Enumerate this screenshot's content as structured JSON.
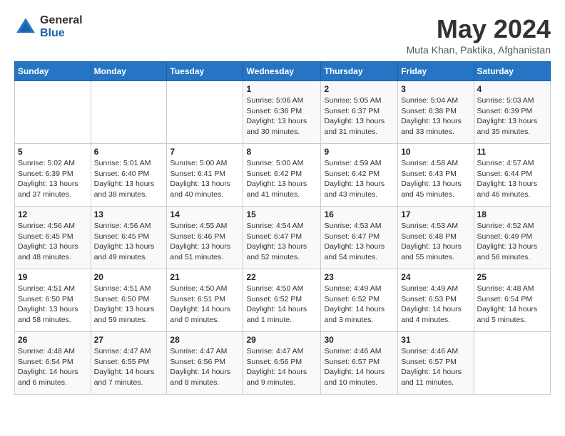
{
  "logo": {
    "general": "General",
    "blue": "Blue"
  },
  "title": "May 2024",
  "location": "Muta Khan, Paktika, Afghanistan",
  "days_header": [
    "Sunday",
    "Monday",
    "Tuesday",
    "Wednesday",
    "Thursday",
    "Friday",
    "Saturday"
  ],
  "weeks": [
    [
      {
        "day": "",
        "detail": ""
      },
      {
        "day": "",
        "detail": ""
      },
      {
        "day": "",
        "detail": ""
      },
      {
        "day": "1",
        "detail": "Sunrise: 5:06 AM\nSunset: 6:36 PM\nDaylight: 13 hours\nand 30 minutes."
      },
      {
        "day": "2",
        "detail": "Sunrise: 5:05 AM\nSunset: 6:37 PM\nDaylight: 13 hours\nand 31 minutes."
      },
      {
        "day": "3",
        "detail": "Sunrise: 5:04 AM\nSunset: 6:38 PM\nDaylight: 13 hours\nand 33 minutes."
      },
      {
        "day": "4",
        "detail": "Sunrise: 5:03 AM\nSunset: 6:39 PM\nDaylight: 13 hours\nand 35 minutes."
      }
    ],
    [
      {
        "day": "5",
        "detail": "Sunrise: 5:02 AM\nSunset: 6:39 PM\nDaylight: 13 hours\nand 37 minutes."
      },
      {
        "day": "6",
        "detail": "Sunrise: 5:01 AM\nSunset: 6:40 PM\nDaylight: 13 hours\nand 38 minutes."
      },
      {
        "day": "7",
        "detail": "Sunrise: 5:00 AM\nSunset: 6:41 PM\nDaylight: 13 hours\nand 40 minutes."
      },
      {
        "day": "8",
        "detail": "Sunrise: 5:00 AM\nSunset: 6:42 PM\nDaylight: 13 hours\nand 41 minutes."
      },
      {
        "day": "9",
        "detail": "Sunrise: 4:59 AM\nSunset: 6:42 PM\nDaylight: 13 hours\nand 43 minutes."
      },
      {
        "day": "10",
        "detail": "Sunrise: 4:58 AM\nSunset: 6:43 PM\nDaylight: 13 hours\nand 45 minutes."
      },
      {
        "day": "11",
        "detail": "Sunrise: 4:57 AM\nSunset: 6:44 PM\nDaylight: 13 hours\nand 46 minutes."
      }
    ],
    [
      {
        "day": "12",
        "detail": "Sunrise: 4:56 AM\nSunset: 6:45 PM\nDaylight: 13 hours\nand 48 minutes."
      },
      {
        "day": "13",
        "detail": "Sunrise: 4:56 AM\nSunset: 6:45 PM\nDaylight: 13 hours\nand 49 minutes."
      },
      {
        "day": "14",
        "detail": "Sunrise: 4:55 AM\nSunset: 6:46 PM\nDaylight: 13 hours\nand 51 minutes."
      },
      {
        "day": "15",
        "detail": "Sunrise: 4:54 AM\nSunset: 6:47 PM\nDaylight: 13 hours\nand 52 minutes."
      },
      {
        "day": "16",
        "detail": "Sunrise: 4:53 AM\nSunset: 6:47 PM\nDaylight: 13 hours\nand 54 minutes."
      },
      {
        "day": "17",
        "detail": "Sunrise: 4:53 AM\nSunset: 6:48 PM\nDaylight: 13 hours\nand 55 minutes."
      },
      {
        "day": "18",
        "detail": "Sunrise: 4:52 AM\nSunset: 6:49 PM\nDaylight: 13 hours\nand 56 minutes."
      }
    ],
    [
      {
        "day": "19",
        "detail": "Sunrise: 4:51 AM\nSunset: 6:50 PM\nDaylight: 13 hours\nand 58 minutes."
      },
      {
        "day": "20",
        "detail": "Sunrise: 4:51 AM\nSunset: 6:50 PM\nDaylight: 13 hours\nand 59 minutes."
      },
      {
        "day": "21",
        "detail": "Sunrise: 4:50 AM\nSunset: 6:51 PM\nDaylight: 14 hours\nand 0 minutes."
      },
      {
        "day": "22",
        "detail": "Sunrise: 4:50 AM\nSunset: 6:52 PM\nDaylight: 14 hours\nand 1 minute."
      },
      {
        "day": "23",
        "detail": "Sunrise: 4:49 AM\nSunset: 6:52 PM\nDaylight: 14 hours\nand 3 minutes."
      },
      {
        "day": "24",
        "detail": "Sunrise: 4:49 AM\nSunset: 6:53 PM\nDaylight: 14 hours\nand 4 minutes."
      },
      {
        "day": "25",
        "detail": "Sunrise: 4:48 AM\nSunset: 6:54 PM\nDaylight: 14 hours\nand 5 minutes."
      }
    ],
    [
      {
        "day": "26",
        "detail": "Sunrise: 4:48 AM\nSunset: 6:54 PM\nDaylight: 14 hours\nand 6 minutes."
      },
      {
        "day": "27",
        "detail": "Sunrise: 4:47 AM\nSunset: 6:55 PM\nDaylight: 14 hours\nand 7 minutes."
      },
      {
        "day": "28",
        "detail": "Sunrise: 4:47 AM\nSunset: 6:56 PM\nDaylight: 14 hours\nand 8 minutes."
      },
      {
        "day": "29",
        "detail": "Sunrise: 4:47 AM\nSunset: 6:56 PM\nDaylight: 14 hours\nand 9 minutes."
      },
      {
        "day": "30",
        "detail": "Sunrise: 4:46 AM\nSunset: 6:57 PM\nDaylight: 14 hours\nand 10 minutes."
      },
      {
        "day": "31",
        "detail": "Sunrise: 4:46 AM\nSunset: 6:57 PM\nDaylight: 14 hours\nand 11 minutes."
      },
      {
        "day": "",
        "detail": ""
      }
    ]
  ]
}
